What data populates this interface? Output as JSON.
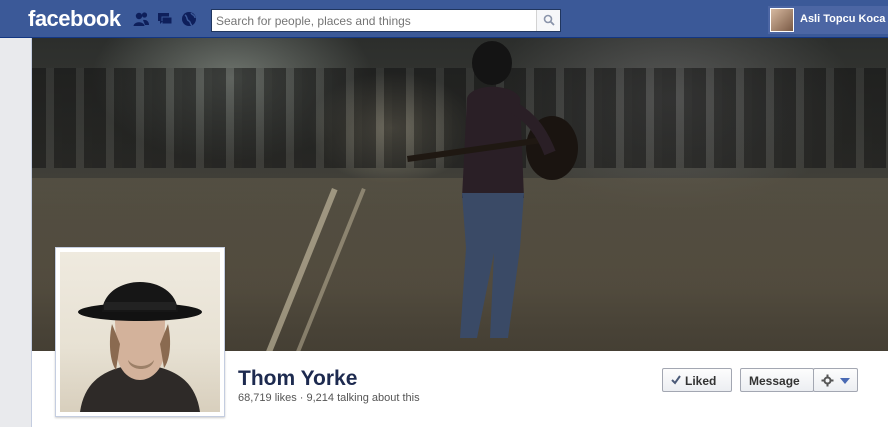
{
  "topbar": {
    "logo": "facebook",
    "icons": [
      "friends-icon",
      "messages-icon",
      "globe-notifications-icon"
    ],
    "search_placeholder": "Search for people, places and things",
    "account_name": "Asli Topcu Koca"
  },
  "page": {
    "name": "Thom Yorke",
    "stats": "68,719 likes · 9,214 talking about this"
  },
  "actions": {
    "liked_label": "Liked",
    "message_label": "Message"
  },
  "colors": {
    "brand": "#3b5998",
    "page_bg": "#e9eaed"
  }
}
